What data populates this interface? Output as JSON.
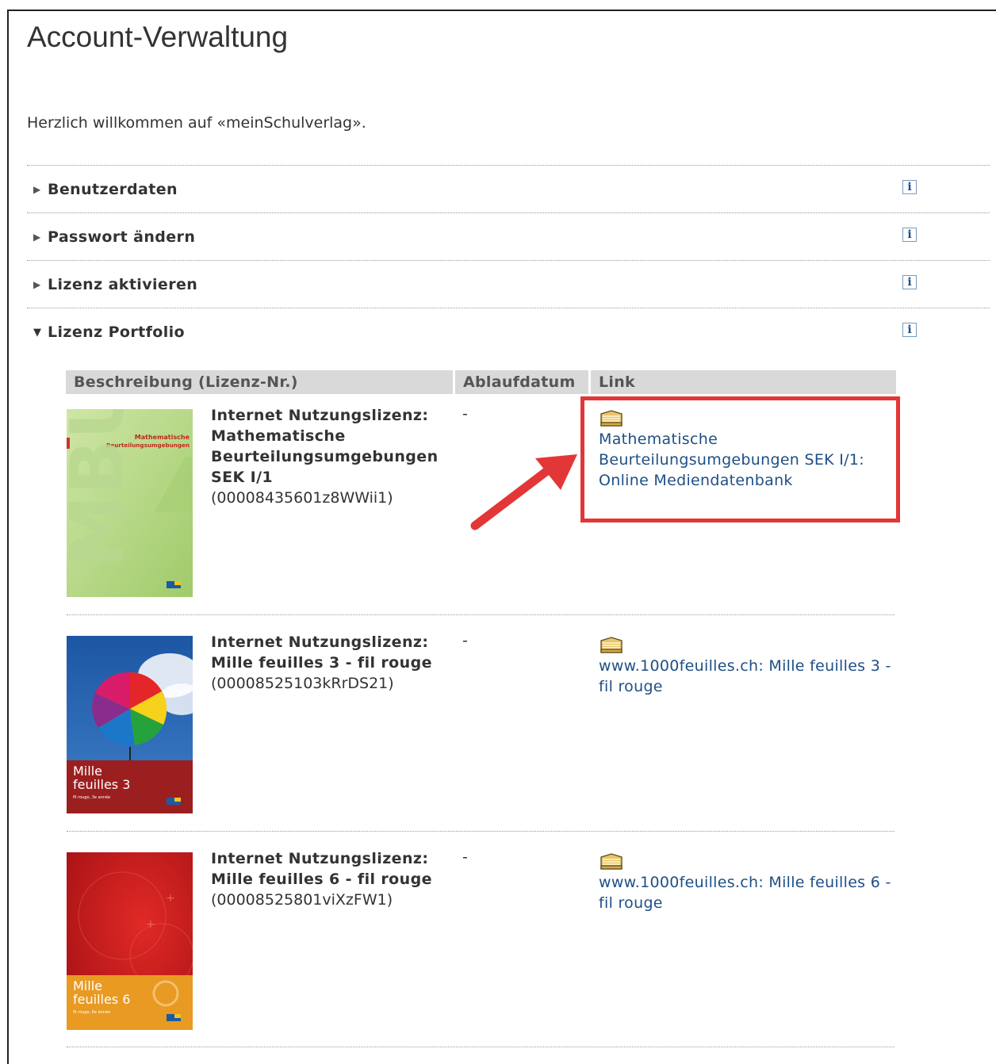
{
  "page": {
    "title": "Account-Verwaltung",
    "welcome": "Herzlich willkommen auf «meinSchulverlag»."
  },
  "accordion": [
    {
      "label": "Benutzerdaten",
      "expanded": false,
      "icon": "info-icon"
    },
    {
      "label": "Passwort ändern",
      "expanded": false,
      "icon": "info-icon"
    },
    {
      "label": "Lizenz aktivieren",
      "expanded": false,
      "icon": "info-icon"
    },
    {
      "label": "Lizenz Portfolio",
      "expanded": true,
      "icon": "info-icon"
    }
  ],
  "table": {
    "headers": [
      "Beschreibung (Lizenz-Nr.)",
      "Ablaufdatum",
      "Link"
    ],
    "rows": [
      {
        "title": "Internet Nutzungslizenz: Mathematische Beurteilungsumgebungen SEK I/1",
        "license": "(00008435601z8WWii1)",
        "expiry": "-",
        "link": "Mathematische Beurteilungsumgebungen SEK I/1: Online Mediendatenbank",
        "cover": {
          "title_line1": "Mathematische",
          "title_line2": "Beurteilungsumgebungen",
          "big_text": "MBU",
          "color": "#b8d98c"
        }
      },
      {
        "title": "Internet Nutzungslizenz: Mille feuilles 3 - fil rouge",
        "license": "(00008525103kRrDS21)",
        "expiry": "-",
        "link": "www.1000feuilles.ch: Mille feuilles 3 - fil rouge",
        "cover": {
          "line1": "Mille",
          "line2": "feuilles 3",
          "sub": "fil rouge, 3e année",
          "color": "#1d5aa6"
        }
      },
      {
        "title": "Internet Nutzungslizenz: Mille feuilles 6 - fil rouge",
        "license": "(00008525801viXzFW1)",
        "expiry": "-",
        "link": "www.1000feuilles.ch: Mille feuilles 6 - fil rouge",
        "cover": {
          "line1": "Mille",
          "line2": "feuilles 6",
          "sub": "fil rouge, 6e année",
          "color": "#c4161c"
        }
      }
    ]
  },
  "colors": {
    "link": "#1e4f86",
    "highlight": "#e33636",
    "header_bg": "#d9d9d9"
  }
}
